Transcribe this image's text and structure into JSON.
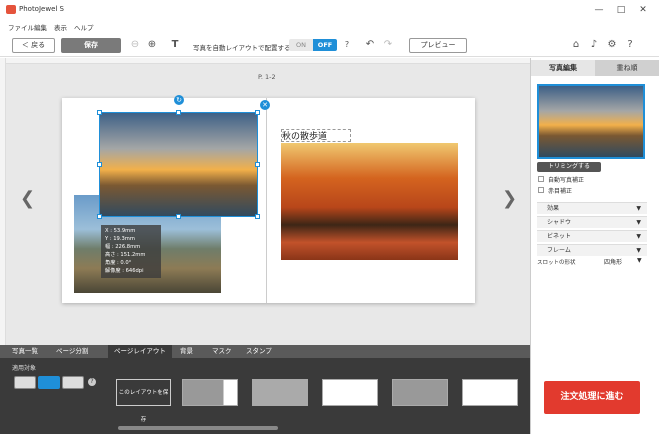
{
  "window": {
    "title": "PhotoJewel S",
    "minimize": "—",
    "maximize": "□",
    "close": "✕"
  },
  "menu": [
    "ファイル",
    "編集",
    "表示",
    "ヘルプ"
  ],
  "toolbar": {
    "back": "＜ 戻る",
    "save": "保存",
    "text_icon": "T",
    "auto_layout_label": "写真を自動レイアウトで配置する",
    "toggle_on": "ON",
    "toggle_off": "OFF",
    "preview": "プレビュー"
  },
  "canvas": {
    "page_label": "P. 1-2",
    "info_lines": [
      "X : 53.9mm",
      "Y : 19.3mm",
      "幅 : 226.8mm",
      "高さ : 151.2mm",
      "角度 : 0.0°",
      "解像度 : 646dpi"
    ],
    "caption": "秋の散歩道"
  },
  "bottom": {
    "tabs": [
      "写真一覧",
      "ページ分割",
      "ページレイアウト",
      "背景",
      "マスク",
      "スタンプ"
    ],
    "apply_label": "適用対象",
    "save_layout": "このレイアウトを保存"
  },
  "right": {
    "tab_edit": "写真編集",
    "tab_order": "重ね順",
    "trim": "トリミングする",
    "auto_correct": "自動写真補正",
    "red_eye": "赤目補正",
    "sections": [
      "効果",
      "シャドウ",
      "ビネット",
      "フレーム"
    ],
    "slot_label": "スロットの形状",
    "slot_value": "四角形",
    "order_button": "注文処理に進む"
  },
  "colors": {
    "accent": "#1f8fd8",
    "order": "#e23a2e"
  }
}
